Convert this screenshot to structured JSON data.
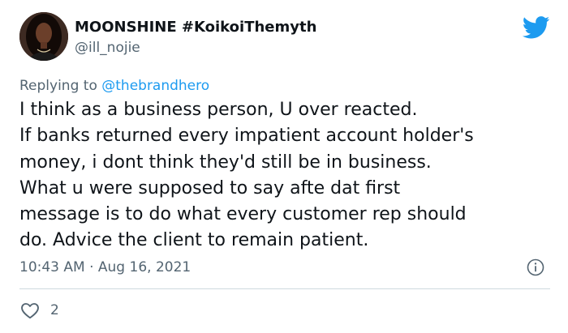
{
  "author": {
    "display_name": "MOONSHINE #KoikoiThemyth",
    "handle": "@ill_nojie",
    "avatar_icon": "profile-photo"
  },
  "reply": {
    "prefix": "Replying to ",
    "mention": "@thebrandhero"
  },
  "tweet": {
    "lines": [
      "I think as a business person, U over reacted.",
      "If banks returned every impatient account holder's",
      "money, i dont think they'd still be in business.",
      "What u were supposed to say afte dat first",
      "message is to do what every customer rep should",
      "do. Advice the client to remain patient."
    ]
  },
  "meta": {
    "timestamp": "10:43 AM · Aug 16, 2021"
  },
  "actions": {
    "like_count": "2"
  },
  "icons": {
    "brand": "twitter-bird-icon",
    "info": "info-icon",
    "like": "heart-icon"
  },
  "colors": {
    "text": "#0f1419",
    "secondary": "#536471",
    "accent": "#1d9bf0",
    "divider": "#cfd9de"
  }
}
